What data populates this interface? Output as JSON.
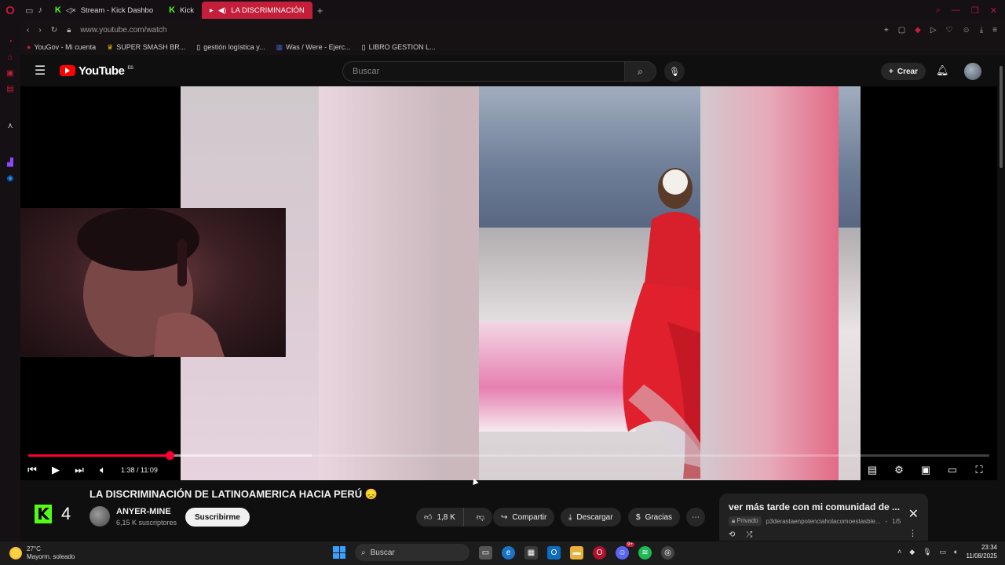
{
  "browser": {
    "tabs": [
      {
        "label": "Stream - Kick Dashbo",
        "active": false
      },
      {
        "label": "Kick",
        "active": false
      },
      {
        "label": "LA DISCRIMINACIÓN",
        "active": true
      }
    ],
    "url": "www.youtube.com/watch",
    "bookmarks": [
      "YouGov - Mi cuenta",
      "SUPER SMASH BR...",
      "gestión logística y...",
      "Was / Were - Ejerc...",
      "LIBRO GESTION L..."
    ]
  },
  "yt": {
    "logo_text": "YouTube",
    "country": "ES",
    "search_placeholder": "Buscar",
    "create_label": "Crear"
  },
  "player": {
    "time": "1:38 / 11:09",
    "progress_fraction": 0.147,
    "loaded_fraction": 0.295
  },
  "video": {
    "title": "LA DISCRIMINACIÓN DE LATINOAMERICA HACIA PERÚ 😞",
    "channel": "ANYER-MINE",
    "subscribers": "6,15 K suscriptores",
    "subscribe_label": "Suscribirme",
    "likes": "1,8 K",
    "share_label": "Compartir",
    "download_label": "Descargar",
    "thanks_label": "Gracias"
  },
  "kick": {
    "viewers": "4"
  },
  "playlist": {
    "title": "ver más tarde con mi comunidad de ...",
    "privacy": "Privado",
    "owner": "p3derastaenpotenciaholacomoestasbie...",
    "position": "1/5"
  },
  "taskbar": {
    "temperature": "27°C",
    "weather": "Mayorm. soleado",
    "search_label": "Buscar",
    "time": "23:34",
    "date": "11/08/2025",
    "notification_badge": "9+"
  }
}
